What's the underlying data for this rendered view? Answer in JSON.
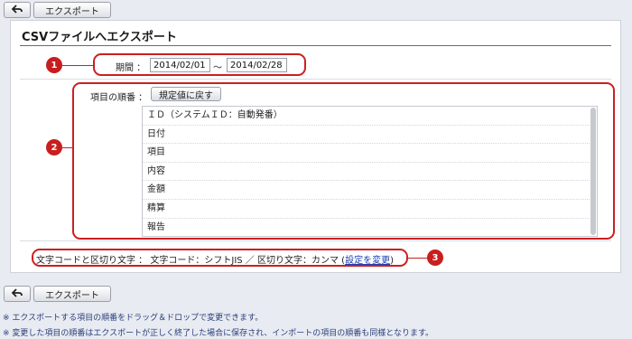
{
  "toolbar": {
    "back_label": "back",
    "export_label": "エクスポート"
  },
  "page_title": "CSVファイルへエクスポート",
  "period": {
    "label": "期間 ：",
    "start": "2014/02/01",
    "separator": "～",
    "end": "2014/02/28"
  },
  "order": {
    "label": "項目の順番 ：",
    "reset_label": "規定値に戻す",
    "items": [
      "ＩＤ（システムＩＤ：自動発番）",
      "日付",
      "項目",
      "内容",
      "金額",
      "精算",
      "報告"
    ]
  },
  "encoding": {
    "label": "文字コードと区切り文字 ：",
    "value": "文字コード：シフトJIS ／ 区切り文字：カンマ",
    "open_paren": "(",
    "change_link": "設定を変更",
    "close_paren": ")"
  },
  "callouts": [
    "1",
    "2",
    "3"
  ],
  "notes": [
    "※ エクスポートする項目の順番をドラッグ＆ドロップで変更できます。",
    "※ 変更した項目の順番はエクスポートが正しく終了した場合に保存され、インポートの項目の順番も同様となります。"
  ],
  "colors": {
    "callout": "#cc1f1f",
    "background": "#e8ebf1",
    "link": "#1a3fb5"
  },
  "icons": {
    "back": "arrow-back-icon"
  }
}
